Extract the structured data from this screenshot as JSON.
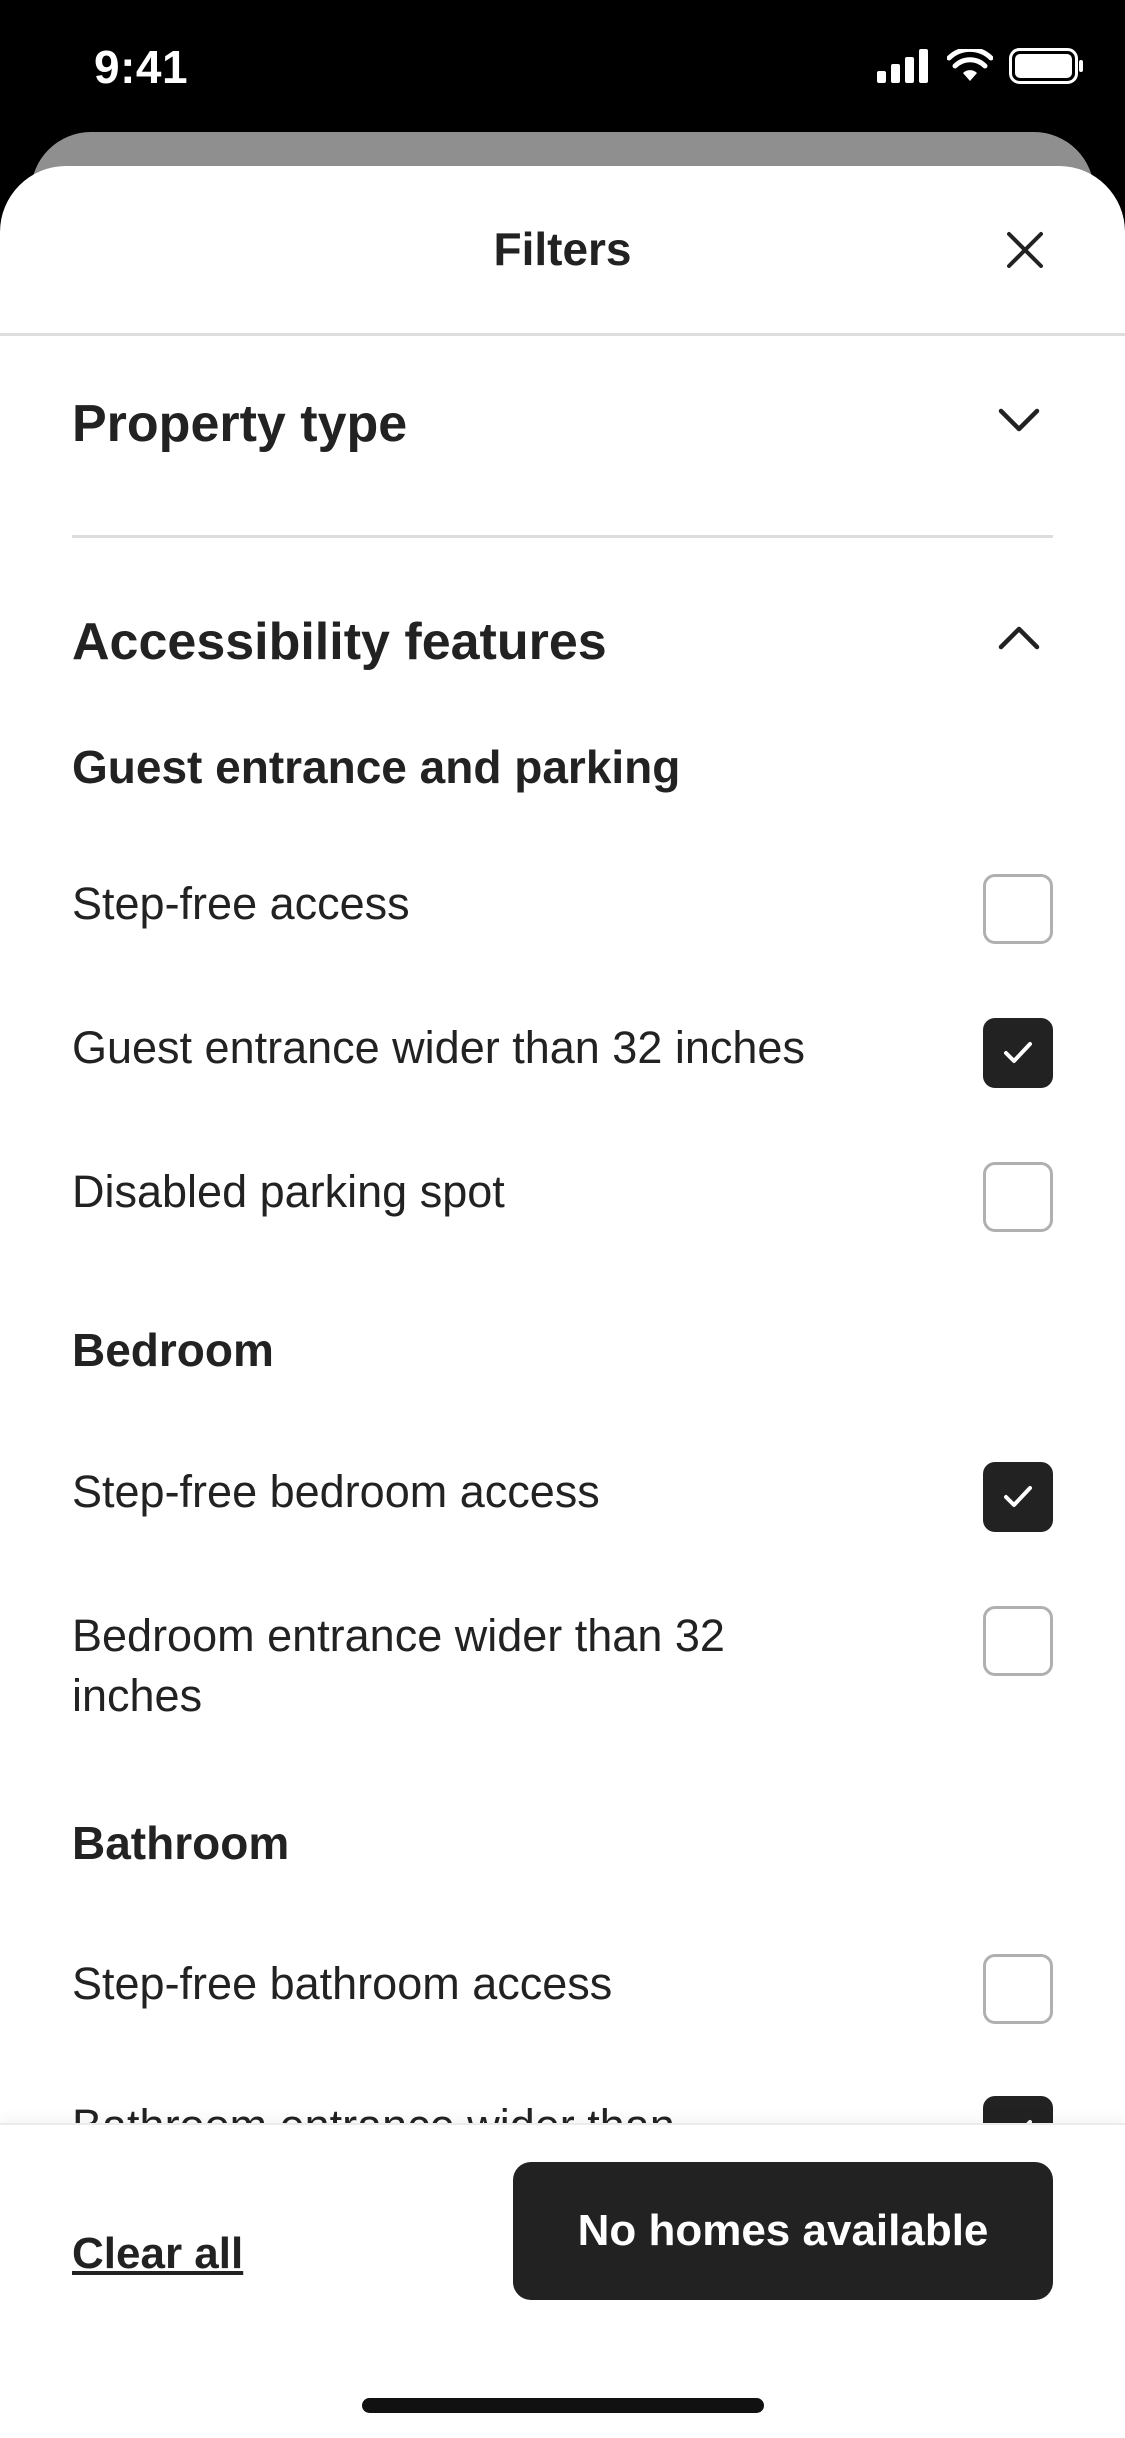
{
  "status_bar": {
    "time": "9:41"
  },
  "sheet": {
    "title": "Filters"
  },
  "sections": {
    "property_type": {
      "title": "Property type"
    },
    "accessibility": {
      "title": "Accessibility features",
      "groups": [
        {
          "heading": "Guest entrance and parking",
          "options": [
            {
              "label": "Step-free access",
              "checked": false
            },
            {
              "label": "Guest entrance wider than 32 inches",
              "checked": true
            },
            {
              "label": "Disabled parking spot",
              "checked": false
            }
          ]
        },
        {
          "heading": "Bedroom",
          "options": [
            {
              "label": "Step-free bedroom access",
              "checked": true
            },
            {
              "label": "Bedroom entrance wider than 32 inches",
              "checked": false
            }
          ]
        },
        {
          "heading": "Bathroom",
          "options": [
            {
              "label": "Step-free bathroom access",
              "checked": false
            },
            {
              "label": "Bathroom entrance wider than",
              "checked": true
            }
          ]
        }
      ]
    }
  },
  "footer": {
    "clear_label": "Clear all",
    "primary_label": "No homes available"
  },
  "colors": {
    "text": "#222222",
    "checked": "#222222",
    "divider": "#DDDDDD"
  }
}
